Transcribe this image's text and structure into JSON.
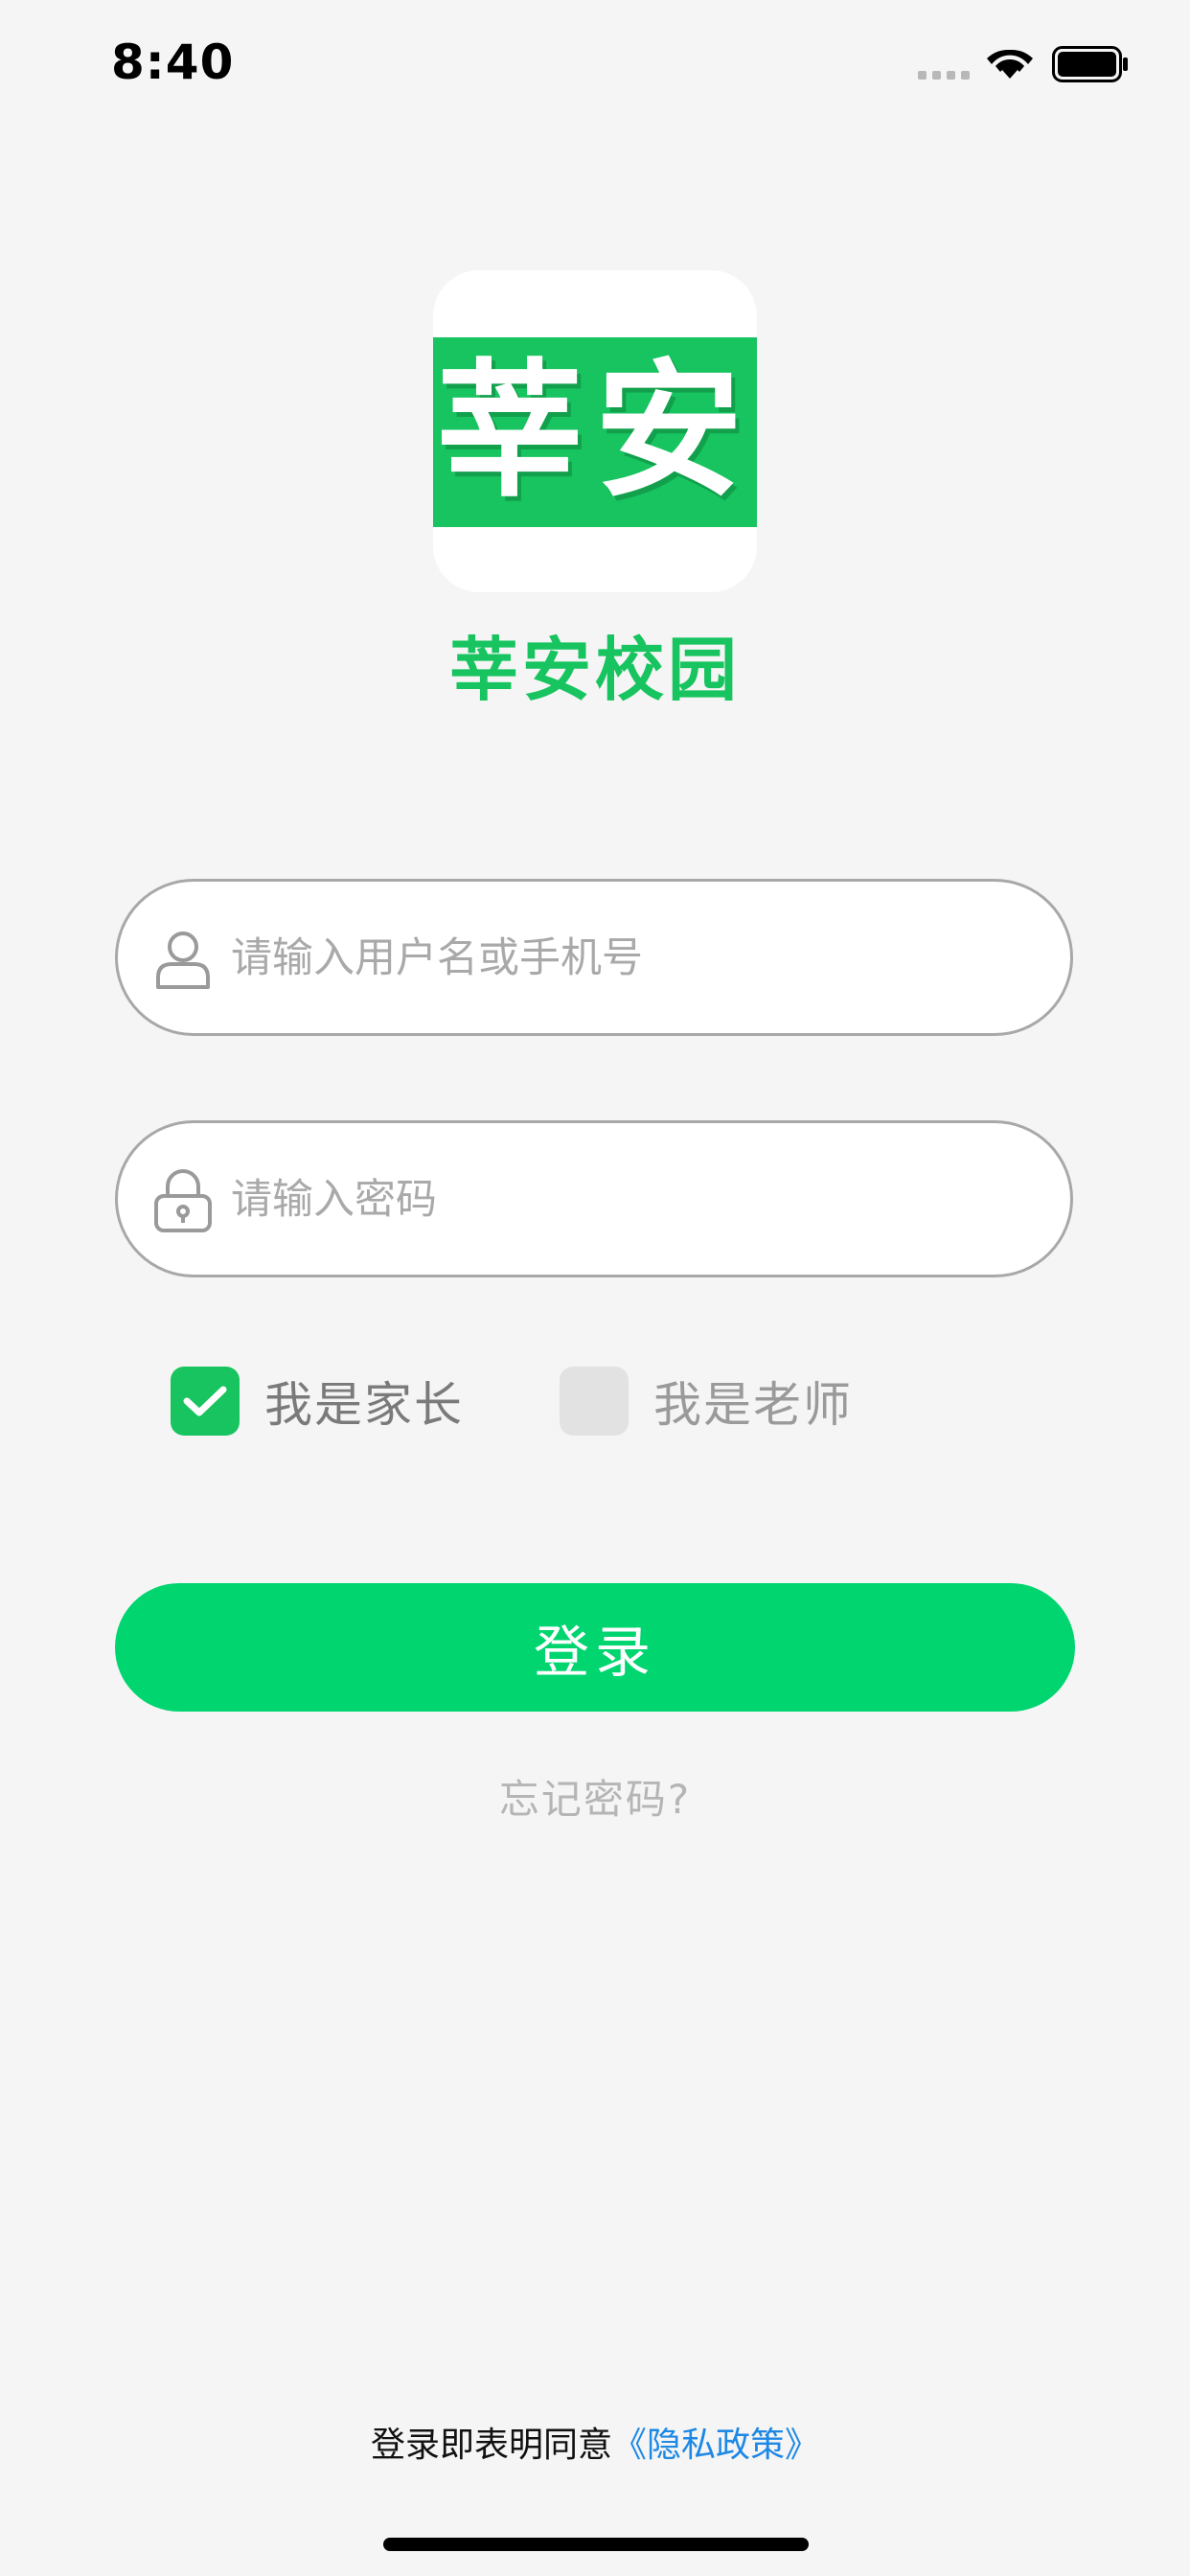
{
  "status_bar": {
    "time": "8:40"
  },
  "logo": {
    "mark": "莘安",
    "app_name": "莘安校园"
  },
  "login_form": {
    "username_placeholder": "请输入用户名或手机号",
    "username_value": "",
    "password_placeholder": "请输入密码",
    "password_value": ""
  },
  "roles": {
    "parent": {
      "label": "我是家长",
      "checked": true
    },
    "teacher": {
      "label": "我是老师",
      "checked": false
    }
  },
  "actions": {
    "login_label": "登录",
    "forgot_label": "忘记密码?"
  },
  "footer": {
    "agreement_prefix": "登录即表明同意",
    "privacy_link": "《隐私政策》"
  },
  "colors": {
    "brand_green": "#17c45f",
    "button_green": "#00d570",
    "link_blue": "#1e88e5",
    "background": "#f5f5f5"
  },
  "icons": [
    "wifi-icon",
    "battery-icon",
    "user-icon",
    "lock-icon",
    "check-icon"
  ]
}
